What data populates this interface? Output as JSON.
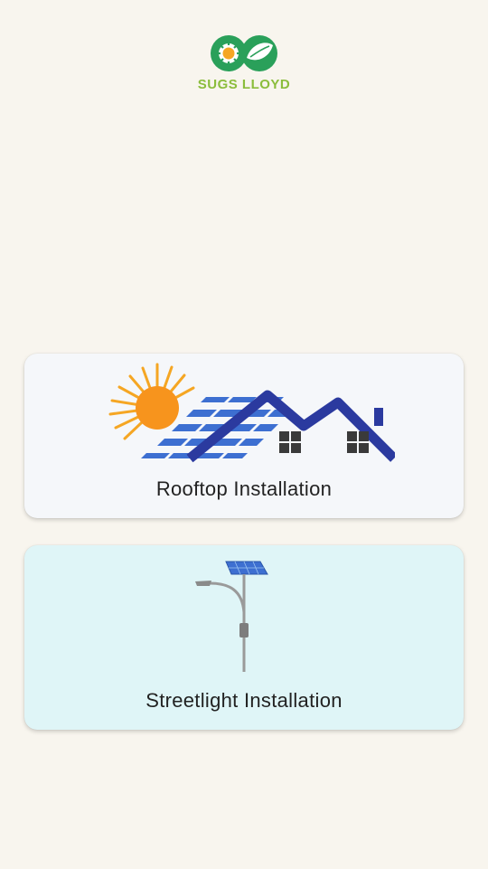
{
  "brand": {
    "name": "SUGS LLOYD",
    "logo_icon": "sun-and-leaf-icon",
    "colors": {
      "green": "#2aa05a",
      "sun": "#f5a623",
      "text": "#8bbd3c"
    }
  },
  "options": [
    {
      "label": "Rooftop Installation",
      "icon": "solar-rooftop-house-icon",
      "background": "#f5f7fa"
    },
    {
      "label": "Streetlight Installation",
      "icon": "solar-streetlight-icon",
      "background": "#dff5f7"
    }
  ]
}
